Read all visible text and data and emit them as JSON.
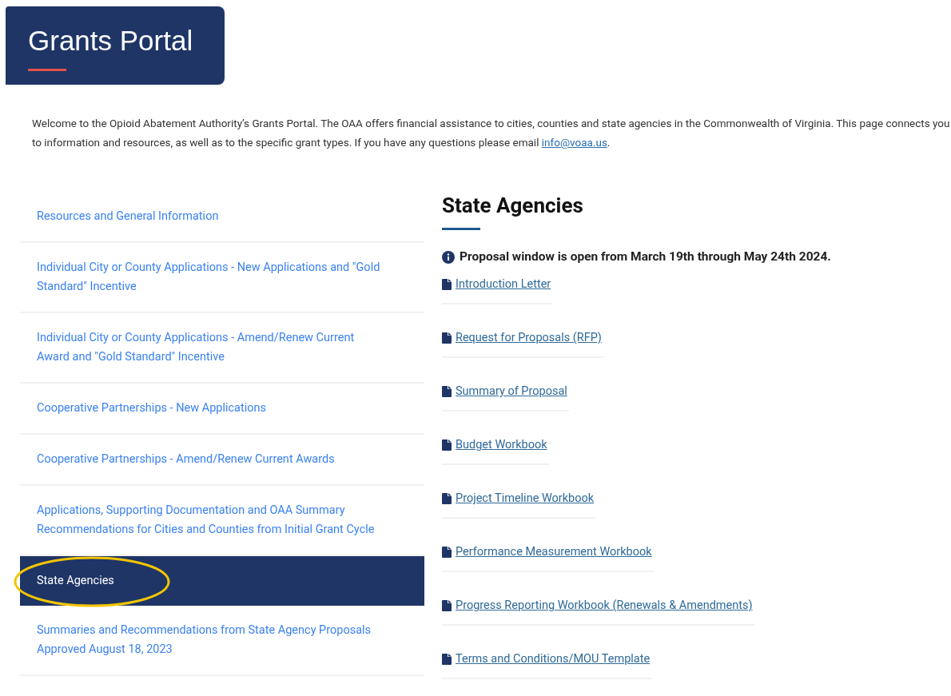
{
  "header": {
    "title": "Grants Portal"
  },
  "intro": {
    "text": "Welcome to the Opioid Abatement Authority’s Grants Portal. The OAA offers financial assistance to cities, counties and state agencies in the Commonwealth of Virginia. This page connects you to information and resources, as well as to the specific grant types.  If you have any questions please email",
    "email": "info@voaa.us",
    "end": "."
  },
  "sidebar": {
    "items": [
      {
        "label": "Resources and General Information",
        "selected": false
      },
      {
        "label": "Individual City or County Applications - New Applications and \"Gold Standard\" Incentive",
        "selected": false
      },
      {
        "label": "Individual City or County Applications - Amend/Renew Current Award and \"Gold Standard\" Incentive",
        "selected": false
      },
      {
        "label": "Cooperative Partnerships - New Applications",
        "selected": false
      },
      {
        "label": "Cooperative Partnerships - Amend/Renew Current Awards",
        "selected": false
      },
      {
        "label": "Applications, Supporting Documentation and OAA Summary Recommendations for Cities and Counties from Initial Grant Cycle",
        "selected": false
      },
      {
        "label": "State Agencies",
        "selected": true,
        "circled": true
      },
      {
        "label": "Summaries and Recommendations from State Agency Proposals Approved August 18, 2023",
        "selected": false
      }
    ]
  },
  "content": {
    "heading": "State Agencies",
    "notice": "Proposal window is open from March 19th through May 24th 2024.",
    "documents": [
      {
        "label": "Introduction Letter"
      },
      {
        "label": "Request for Proposals (RFP)"
      },
      {
        "label": "Summary of Proposal"
      },
      {
        "label": "Budget Workbook"
      },
      {
        "label": "Project Timeline Workbook"
      },
      {
        "label": "Performance Measurement Workbook"
      },
      {
        "label": "Progress Reporting Workbook (Renewals & Amendments)"
      },
      {
        "label": "Terms and Conditions/MOU Template"
      }
    ]
  }
}
